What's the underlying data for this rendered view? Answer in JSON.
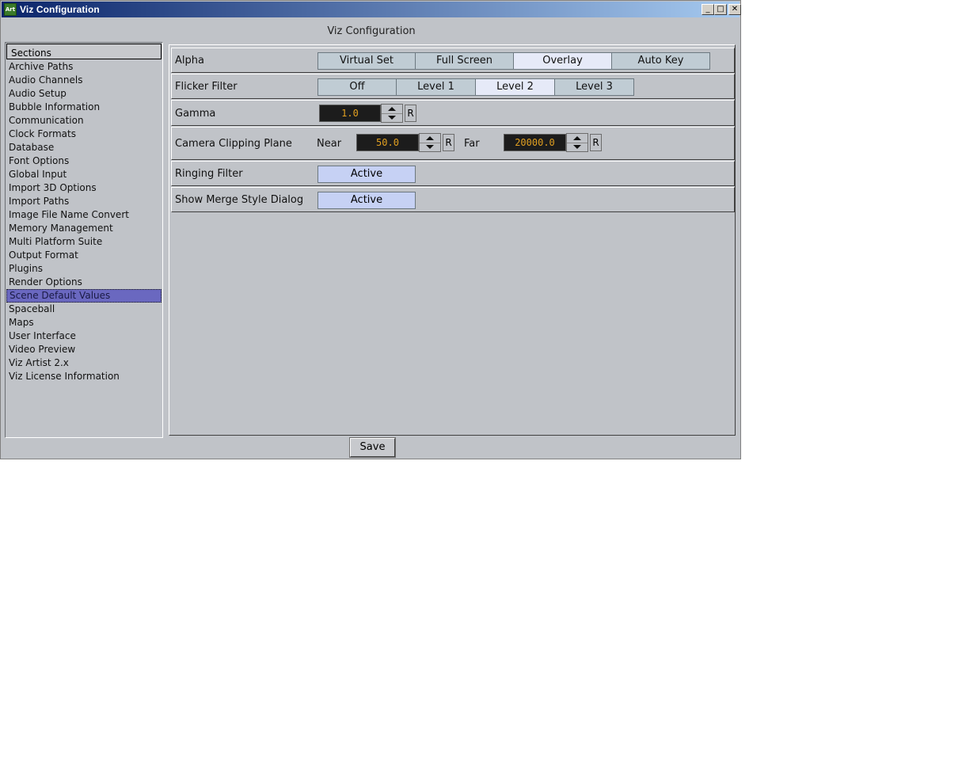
{
  "window": {
    "title": "Viz Configuration",
    "app_icon_text": "Art",
    "controls": {
      "minimize": "_",
      "maximize": "□",
      "close": "✕"
    }
  },
  "header": {
    "title": "Viz Configuration"
  },
  "sections": {
    "header": "Sections",
    "items": [
      {
        "label": "Archive Paths"
      },
      {
        "label": "Audio Channels"
      },
      {
        "label": "Audio Setup"
      },
      {
        "label": "Bubble Information"
      },
      {
        "label": "Communication"
      },
      {
        "label": "Clock Formats"
      },
      {
        "label": "Database"
      },
      {
        "label": "Font Options"
      },
      {
        "label": "Global Input"
      },
      {
        "label": "Import 3D Options"
      },
      {
        "label": "Import Paths"
      },
      {
        "label": "Image File Name Convert"
      },
      {
        "label": "Memory Management"
      },
      {
        "label": "Multi Platform Suite"
      },
      {
        "label": "Output Format"
      },
      {
        "label": "Plugins"
      },
      {
        "label": "Render Options"
      },
      {
        "label": "Scene Default Values"
      },
      {
        "label": "Spaceball"
      },
      {
        "label": "Maps"
      },
      {
        "label": "User Interface"
      },
      {
        "label": "Video Preview"
      },
      {
        "label": "Viz Artist 2.x"
      },
      {
        "label": "Viz License Information"
      }
    ],
    "selected": "Scene Default Values"
  },
  "settings": {
    "alpha": {
      "label": "Alpha",
      "options": [
        "Virtual Set",
        "Full Screen",
        "Overlay",
        "Auto Key"
      ],
      "selected": "Overlay"
    },
    "flicker_filter": {
      "label": "Flicker Filter",
      "options": [
        "Off",
        "Level 1",
        "Level 2",
        "Level 3"
      ],
      "selected": "Level 2"
    },
    "gamma": {
      "label": "Gamma",
      "value": "1.0",
      "reset": "R"
    },
    "camera_clipping_plane": {
      "label": "Camera Clipping Plane",
      "near_label": "Near",
      "near_value": "50.0",
      "far_label": "Far",
      "far_value": "20000.0",
      "reset": "R"
    },
    "ringing_filter": {
      "label": "Ringing Filter",
      "state": "Active"
    },
    "show_merge_style_dialog": {
      "label": "Show Merge Style Dialog",
      "state": "Active"
    }
  },
  "footer": {
    "save_label": "Save"
  },
  "colors": {
    "background": "#c0c3c8",
    "selection": "#6a68c0",
    "numeric_text": "#e1a021",
    "numeric_field": "#1c1c1c",
    "active_button": "#c6d1f4",
    "selected_segment": "#e6eaf8"
  }
}
